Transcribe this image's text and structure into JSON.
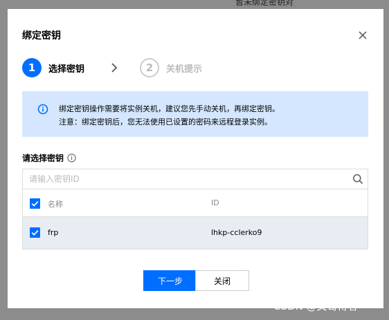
{
  "background": {
    "text": "暂未绑定密钥对"
  },
  "modal": {
    "title": "绑定密钥",
    "close_icon": "close-icon"
  },
  "steps": [
    {
      "number": "1",
      "label": "选择密钥",
      "state": "active"
    },
    {
      "number": "2",
      "label": "关机提示",
      "state": "inactive"
    }
  ],
  "alert": {
    "icon": "info-circle-icon",
    "line1": "绑定密钥操作需要将实例关机，建议您先手动关机，再绑定密钥。",
    "line2": "注意：绑定密钥后，您无法使用已设置的密码来远程登录实例。"
  },
  "select_section": {
    "label": "请选择密钥"
  },
  "search": {
    "placeholder": "请输入密钥ID",
    "value": ""
  },
  "table": {
    "columns": [
      "名称",
      "ID"
    ],
    "rows": [
      {
        "name": "frp",
        "id": "lhkp-cclerko9",
        "checked": true
      }
    ],
    "all_checked": true
  },
  "footer": {
    "next_label": "下一步",
    "close_label": "关闭"
  },
  "watermark": "CSDN @文哥博客",
  "colors": {
    "accent": "#006eff",
    "alert_bg": "#d5e7ff",
    "row_selected_bg": "#e8ecf3",
    "overlay": "#8c8c8c"
  }
}
